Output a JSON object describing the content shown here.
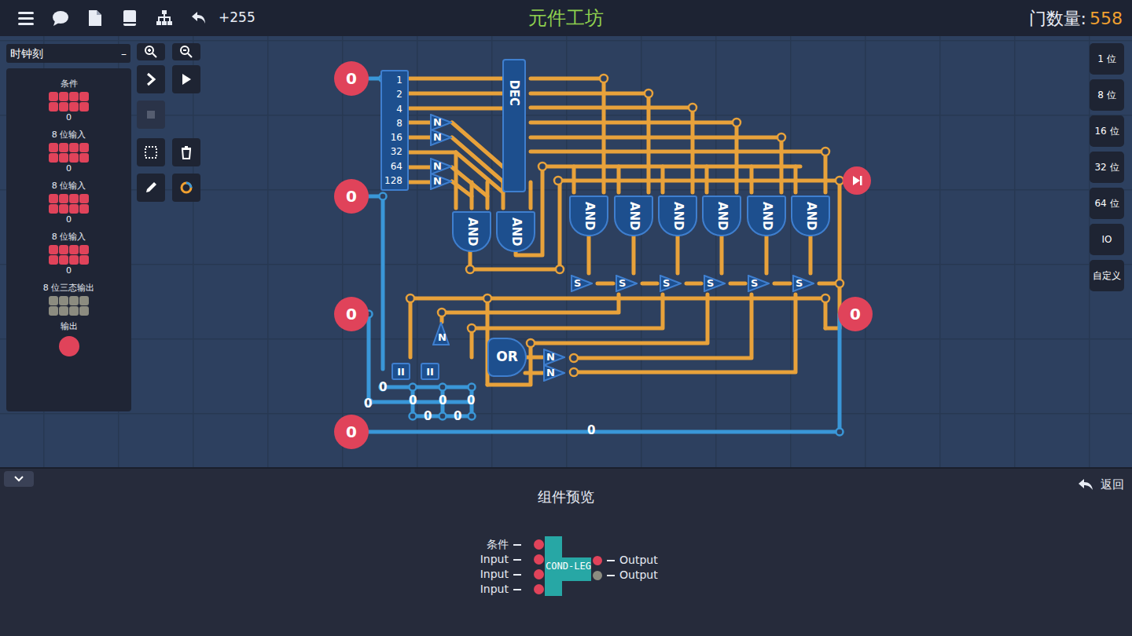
{
  "top_bar": {
    "undo_count": "+255",
    "title": "元件工坊",
    "gate_count_label": "门数量:",
    "gate_count": "558"
  },
  "left_panel": {
    "dropdown": "时钟刻",
    "collapse": "–",
    "components": [
      {
        "label": "条件",
        "count": "0",
        "kind": "input"
      },
      {
        "label": "8 位输入",
        "count": "0",
        "kind": "input"
      },
      {
        "label": "8 位输入",
        "count": "0",
        "kind": "input"
      },
      {
        "label": "8 位输入",
        "count": "0",
        "kind": "input"
      },
      {
        "label": "8 位三态输出",
        "count": "",
        "kind": "tristate"
      },
      {
        "label": "输出",
        "count": "",
        "kind": "output"
      }
    ]
  },
  "right_panel": {
    "buttons": [
      "1 位",
      "8 位",
      "16 位",
      "32 位",
      "64 位",
      "IO",
      "自定义"
    ]
  },
  "canvas": {
    "pins": [
      {
        "value": "0",
        "kind": "input"
      },
      {
        "value": "0",
        "kind": "input"
      },
      {
        "value": "0",
        "kind": "input"
      },
      {
        "value": "0",
        "kind": "input"
      },
      {
        "value": "0",
        "kind": "output"
      }
    ],
    "splitter": {
      "bits": [
        "1",
        "2",
        "4",
        "8",
        "16",
        "32",
        "64",
        "128"
      ]
    },
    "gates": [
      {
        "label": "DEC",
        "kind": "decoder"
      },
      {
        "label": "N",
        "kind": "not"
      },
      {
        "label": "N",
        "kind": "not"
      },
      {
        "label": "N",
        "kind": "not"
      },
      {
        "label": "N",
        "kind": "not"
      },
      {
        "label": "AND",
        "kind": "and"
      },
      {
        "label": "AND",
        "kind": "and"
      },
      {
        "label": "AND",
        "kind": "and"
      },
      {
        "label": "AND",
        "kind": "and"
      },
      {
        "label": "AND",
        "kind": "and"
      },
      {
        "label": "AND",
        "kind": "and"
      },
      {
        "label": "AND",
        "kind": "and"
      },
      {
        "label": "AND",
        "kind": "and"
      },
      {
        "label": "S",
        "kind": "switch"
      },
      {
        "label": "S",
        "kind": "switch"
      },
      {
        "label": "S",
        "kind": "switch"
      },
      {
        "label": "S",
        "kind": "switch"
      },
      {
        "label": "S",
        "kind": "switch"
      },
      {
        "label": "S",
        "kind": "switch"
      },
      {
        "label": "N",
        "kind": "not"
      },
      {
        "label": "OR",
        "kind": "or"
      },
      {
        "label": "N",
        "kind": "not"
      },
      {
        "label": "N",
        "kind": "not"
      },
      {
        "label": "II",
        "kind": "delay"
      },
      {
        "label": "II",
        "kind": "delay"
      }
    ],
    "wire_values": [
      "0",
      "0",
      "0",
      "0",
      "0",
      "0",
      "0",
      "0"
    ]
  },
  "preview": {
    "title": "组件预览",
    "back": "返回",
    "component": {
      "name": "COND-LEG",
      "inputs": [
        "条件",
        "Input",
        "Input",
        "Input"
      ],
      "outputs": [
        {
          "label": "Output",
          "kind": "bit"
        },
        {
          "label": "Output",
          "kind": "tristate"
        }
      ]
    }
  }
}
